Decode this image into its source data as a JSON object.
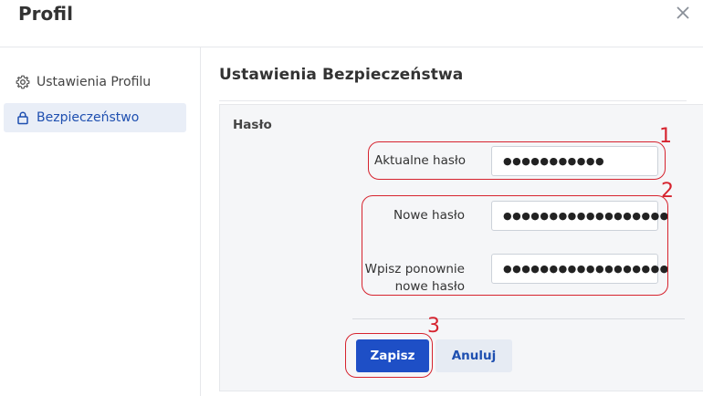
{
  "dialog": {
    "title": "Profil",
    "close_icon": "close-icon"
  },
  "sidebar": {
    "items": [
      {
        "label": "Ustawienia Profilu",
        "icon": "gear-icon",
        "active": false
      },
      {
        "label": "Bezpieczeństwo",
        "icon": "lock-icon",
        "active": true
      }
    ]
  },
  "main": {
    "section_title": "Ustawienia Bezpieczeństwa",
    "password_group_label": "Hasło",
    "fields": {
      "current": {
        "label": "Aktualne hasło",
        "masked_value": "●●●●●●●●●●●"
      },
      "new": {
        "label": "Nowe hasło",
        "masked_value": "●●●●●●●●●●●●●●●●●●"
      },
      "repeat": {
        "label_line1": "Wpisz ponownie",
        "label_line2": "nowe hasło",
        "masked_value": "●●●●●●●●●●●●●●●●●●"
      }
    },
    "buttons": {
      "save": "Zapisz",
      "cancel": "Anuluj"
    }
  },
  "annotations": {
    "color": "#d6232e",
    "labels": [
      "1",
      "2",
      "3"
    ]
  },
  "colors": {
    "accent": "#1e4fc6",
    "active_bg": "#e9eef7",
    "panel_bg": "#f5f6f8"
  }
}
